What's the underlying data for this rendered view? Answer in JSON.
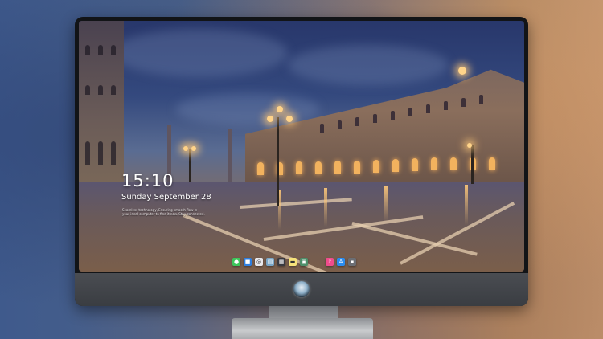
{
  "lock_screen": {
    "time": "15:10",
    "date": "Sunday September 28",
    "caption_line1": "Seamless technology, Ensuring smooth flow in",
    "caption_line2": "your ideal computer to find it now. Stay connected."
  },
  "dock": {
    "icons": [
      {
        "name": "messages-icon",
        "color": "#3cc65a",
        "glyph": "●"
      },
      {
        "name": "finder-icon",
        "color": "#2f7fe0",
        "glyph": "■"
      },
      {
        "name": "safari-icon",
        "color": "#e8e8ec",
        "glyph": "◎"
      },
      {
        "name": "preview-icon",
        "color": "#7aa6c6",
        "glyph": "▤"
      },
      {
        "name": "clapper-icon",
        "color": "#3a3a40",
        "glyph": "▦"
      },
      {
        "name": "notes-icon",
        "color": "#f6e27a",
        "glyph": "▬"
      },
      {
        "name": "photos-icon",
        "color": "#4d8f6a",
        "glyph": "▣"
      },
      {
        "name": "music-icon",
        "color": "#f04c8c",
        "glyph": "♪"
      },
      {
        "name": "app-store-icon",
        "color": "#2a8cf0",
        "glyph": "A"
      },
      {
        "name": "camera-icon",
        "color": "#6b6e74",
        "glyph": "▪"
      }
    ]
  },
  "colors": {
    "monitor_frame": "#121417",
    "chin": "#3a3d42",
    "lamp_glow": "#ffd48a"
  }
}
